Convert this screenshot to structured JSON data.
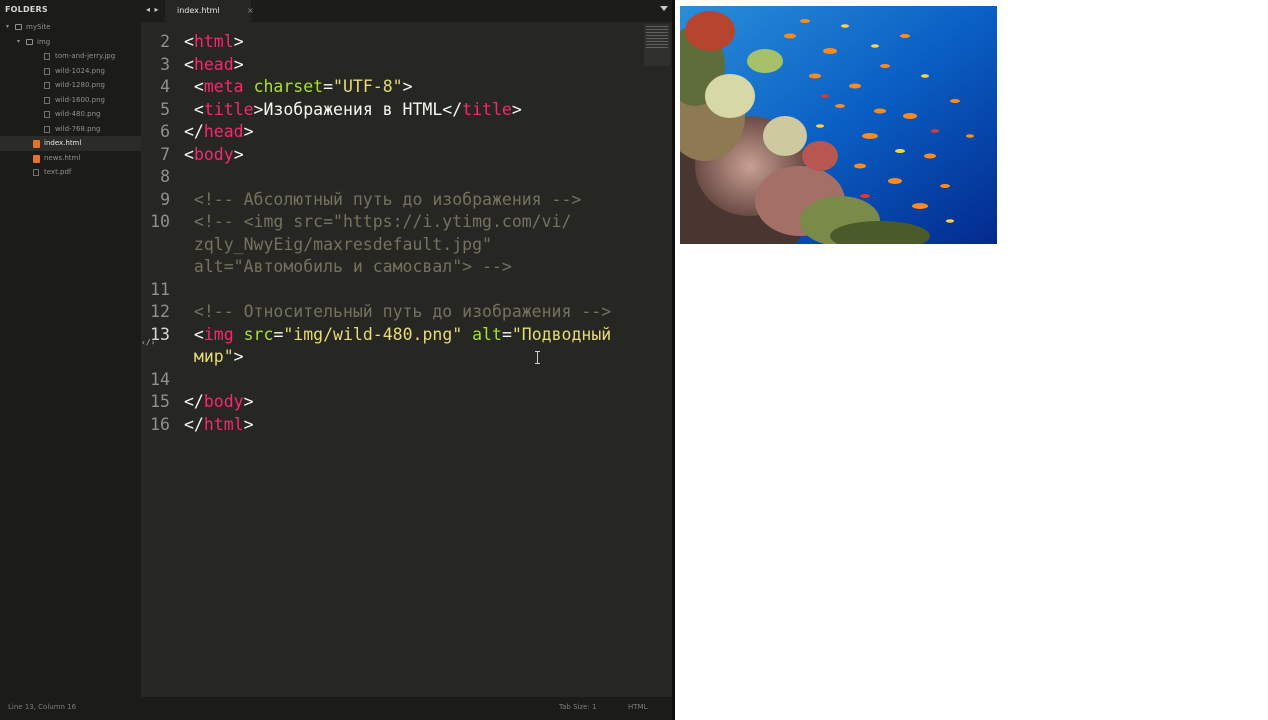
{
  "sidebar": {
    "header": "FOLDERS",
    "items": [
      {
        "label": "mySite",
        "kind": "folder",
        "depth": 0,
        "open": true
      },
      {
        "label": "img",
        "kind": "folder",
        "depth": 1,
        "open": true
      },
      {
        "label": "tom-and-jerry.jpg",
        "kind": "file",
        "depth": 2
      },
      {
        "label": "wild-1024.png",
        "kind": "file",
        "depth": 2
      },
      {
        "label": "wild-1280.png",
        "kind": "file",
        "depth": 2
      },
      {
        "label": "wild-1600.png",
        "kind": "file",
        "depth": 2
      },
      {
        "label": "wild-480.png",
        "kind": "file",
        "depth": 2
      },
      {
        "label": "wild-768.png",
        "kind": "file",
        "depth": 2
      },
      {
        "label": "index.html",
        "kind": "html",
        "depth": 1,
        "active": true
      },
      {
        "label": "news.html",
        "kind": "html",
        "depth": 1
      },
      {
        "label": "text.pdf",
        "kind": "pdf",
        "depth": 1
      }
    ]
  },
  "tabbar": {
    "nav_arrows": "◂ ▸",
    "active_tab": "index.html",
    "close_glyph": "×"
  },
  "editor": {
    "lines": [
      {
        "n": "2",
        "segs": [
          [
            "p",
            "<"
          ],
          [
            "t",
            "html"
          ],
          [
            "p",
            ">"
          ]
        ]
      },
      {
        "n": "3",
        "segs": [
          [
            "p",
            "<"
          ],
          [
            "t",
            "head"
          ],
          [
            "p",
            ">"
          ]
        ]
      },
      {
        "n": "4",
        "segs": [
          [
            "p",
            " <"
          ],
          [
            "t",
            "meta"
          ],
          [
            "p",
            " "
          ],
          [
            "a",
            "charset"
          ],
          [
            "p",
            "="
          ],
          [
            "s",
            "\"UTF-8\""
          ],
          [
            "p",
            ">"
          ]
        ]
      },
      {
        "n": "5",
        "segs": [
          [
            "p",
            " <"
          ],
          [
            "t",
            "title"
          ],
          [
            "p",
            ">Изображения в HTML</"
          ],
          [
            "t",
            "title"
          ],
          [
            "p",
            ">"
          ]
        ]
      },
      {
        "n": "6",
        "segs": [
          [
            "p",
            "</"
          ],
          [
            "t",
            "head"
          ],
          [
            "p",
            ">"
          ]
        ]
      },
      {
        "n": "7",
        "segs": [
          [
            "p",
            "<"
          ],
          [
            "t",
            "body"
          ],
          [
            "p",
            ">"
          ]
        ]
      },
      {
        "n": "8",
        "segs": []
      },
      {
        "n": "9",
        "segs": [
          [
            "c",
            " <!-- Абсолютный путь до изображения -->"
          ]
        ]
      },
      {
        "n": "10",
        "segs": [
          [
            "c",
            " <!-- <img src=\"https://i.ytimg.com/vi/"
          ]
        ]
      },
      {
        "n": "",
        "segs": [
          [
            "c",
            " zqly_NwyEig/maxresdefault.jpg\""
          ]
        ]
      },
      {
        "n": "",
        "segs": [
          [
            "c",
            " alt=\"Автомобиль и самосвал\"> -->"
          ]
        ]
      },
      {
        "n": "11",
        "segs": []
      },
      {
        "n": "12",
        "segs": [
          [
            "c",
            " <!-- Относительный путь до изображения -->"
          ]
        ]
      },
      {
        "n": "13",
        "cur": true,
        "segs": [
          [
            "p",
            " <"
          ],
          [
            "t",
            "img"
          ],
          [
            "p",
            " "
          ],
          [
            "a",
            "src"
          ],
          [
            "p",
            "="
          ],
          [
            "s",
            "\"img/wild-480.png\""
          ],
          [
            "p",
            " "
          ],
          [
            "a",
            "alt"
          ],
          [
            "p",
            "="
          ],
          [
            "s",
            "\"Подводный"
          ]
        ]
      },
      {
        "n": "",
        "segs": [
          [
            "s",
            " мир\""
          ],
          [
            "p",
            ">"
          ]
        ]
      },
      {
        "n": "14",
        "segs": []
      },
      {
        "n": "15",
        "segs": [
          [
            "p",
            "</"
          ],
          [
            "t",
            "body"
          ],
          [
            "p",
            ">"
          ]
        ]
      },
      {
        "n": "16",
        "segs": [
          [
            "p",
            "</"
          ],
          [
            "t",
            "html"
          ],
          [
            "p",
            ">"
          ]
        ]
      }
    ]
  },
  "statusbar": {
    "position": "Line 13, Column 16",
    "tab_size": "Tab Size: 1",
    "syntax": "HTML"
  },
  "preview": {
    "image_alt": "Подводный мир"
  },
  "colors": {
    "tag": "#f92672",
    "attr": "#a6e22e",
    "string": "#e6db74",
    "comment": "#75715e",
    "text": "#f8f8f2"
  }
}
